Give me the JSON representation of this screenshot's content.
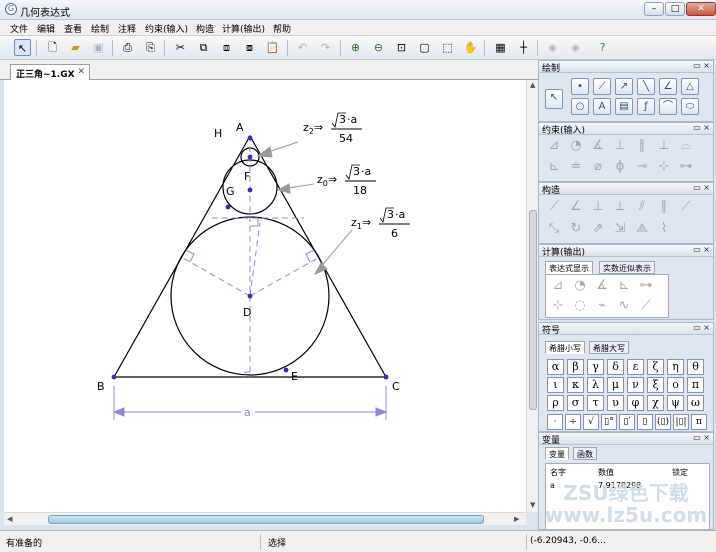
{
  "window": {
    "title": "几何表达式",
    "icon": "G"
  },
  "menu": [
    "文件",
    "编辑",
    "查看",
    "绘制",
    "注释",
    "约束(输入)",
    "构造",
    "计算(输出)",
    "帮助"
  ],
  "doc_tab": "正三角~1.GX",
  "canvas": {
    "points": {
      "A": "A",
      "B": "B",
      "C": "C",
      "D": "D",
      "E": "E",
      "F": "F",
      "G": "G",
      "H": "H"
    },
    "dim_label": "a",
    "z2": {
      "lhs": "z",
      "sub": "2",
      "arrow": "⇒",
      "radicand": "3",
      "num_tail": "·a",
      "den": "54"
    },
    "z0": {
      "lhs": "z",
      "sub": "0",
      "arrow": "⇒",
      "radicand": "3",
      "num_tail": "·a",
      "den": "18"
    },
    "z1": {
      "lhs": "z",
      "sub": "1",
      "arrow": "⇒",
      "radicand": "3",
      "num_tail": "·a",
      "den": "6"
    }
  },
  "panels": {
    "draw": {
      "title": "绘制"
    },
    "constraint": {
      "title": "约束(输入)"
    },
    "construct": {
      "title": "构造"
    },
    "compute": {
      "title": "计算(输出)",
      "tabs": [
        "表达式显示",
        "实数近似表示"
      ]
    },
    "symbols": {
      "title": "符号",
      "tabs": [
        "希腊小写",
        "希腊大写"
      ],
      "greek": [
        "α",
        "β",
        "γ",
        "δ",
        "ε",
        "ζ",
        "η",
        "θ",
        "ι",
        "κ",
        "λ",
        "μ",
        "ν",
        "ξ",
        "ο",
        "π",
        "ρ",
        "σ",
        "τ",
        "υ",
        "φ",
        "χ",
        "ψ",
        "ω"
      ],
      "ops": [
        "·",
        "÷",
        "√",
        "▯°",
        "▯′",
        "▯",
        "(▯)",
        "|▯|",
        "π"
      ]
    },
    "vars": {
      "title": "变量",
      "tabs": [
        "变量",
        "函数"
      ],
      "headers": [
        "名字",
        "数值",
        "锁定"
      ],
      "row": {
        "name": "a",
        "value": "7.9178298"
      }
    },
    "pin_buttons": "▭ ×"
  },
  "status": {
    "ready": "有准备的",
    "mode": "选择",
    "coords": "(-6.20943, -0.6..."
  },
  "watermark": {
    "line1": "ZSU绿色下载",
    "line2": "www.lz5u.com"
  }
}
